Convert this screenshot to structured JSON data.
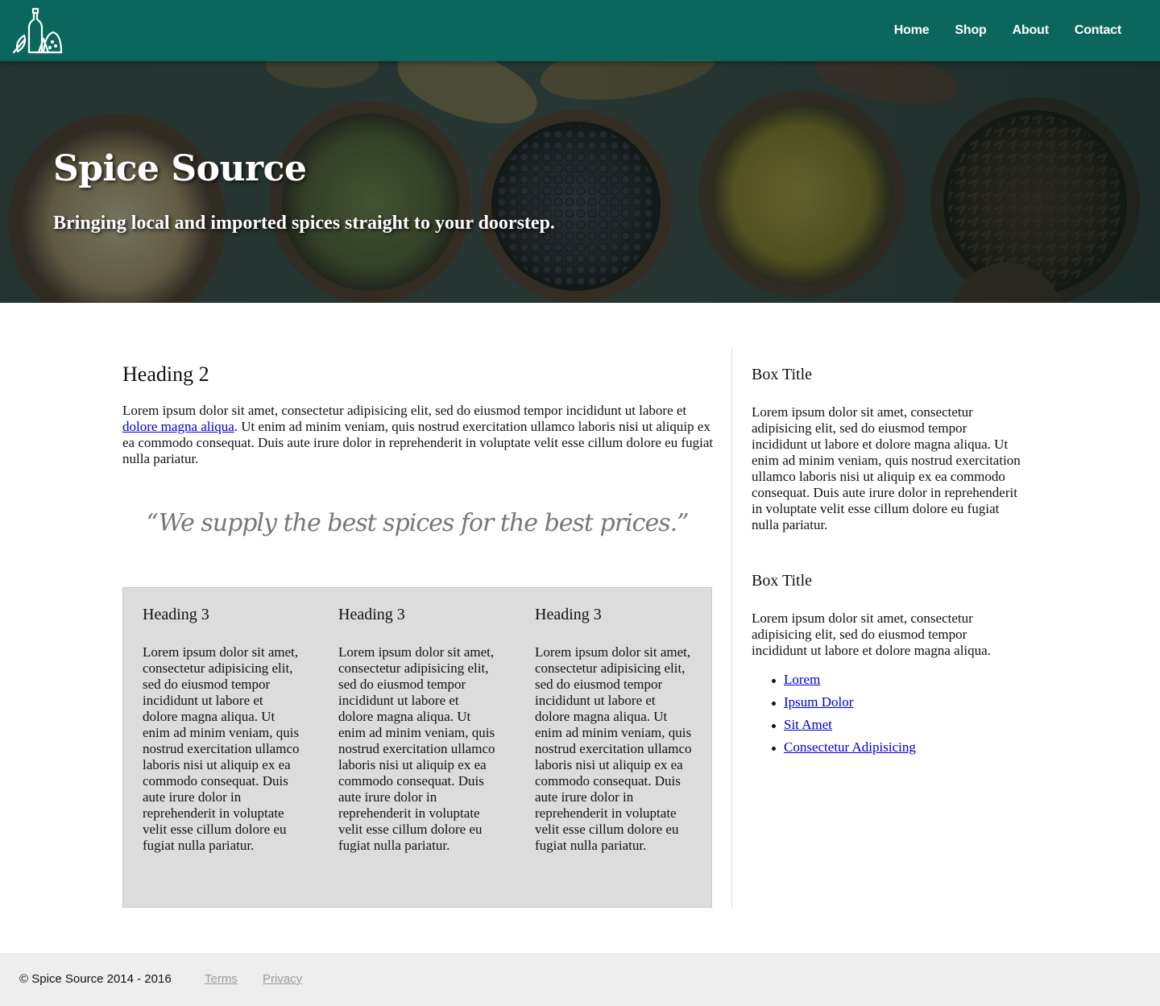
{
  "header": {
    "logo_icon": "spice-jars-logo-icon",
    "background_color": "#0b675d",
    "nav": [
      {
        "label": "Home"
      },
      {
        "label": "Shop"
      },
      {
        "label": "About"
      },
      {
        "label": "Contact"
      }
    ]
  },
  "hero": {
    "title": "Spice Source",
    "tagline": "Bringing local and imported spices straight to your doorstep."
  },
  "main": {
    "heading": "Heading 2",
    "paragraph_before_link": "Lorem ipsum dolor sit amet, consectetur adipisicing elit, sed do eiusmod tempor incididunt ut labore et ",
    "paragraph_link": "dolore magna aliqua",
    "paragraph_after_link": ". Ut enim ad minim veniam, quis nostrud exercitation ullamco laboris nisi ut aliquip ex ea commodo consequat. Duis aute irure dolor in reprehenderit in voluptate velit esse cillum dolore eu fugiat nulla pariatur.",
    "quote": "“We supply the best spices for the best prices.”",
    "columns": [
      {
        "heading": "Heading 3",
        "text": "Lorem ipsum dolor sit amet, consectetur adipisicing elit, sed do eiusmod tempor incididunt ut labore et dolore magna aliqua. Ut enim ad minim veniam, quis nostrud exercitation ullamco laboris nisi ut aliquip ex ea commodo consequat. Duis aute irure dolor in reprehenderit in voluptate velit esse cillum dolore eu fugiat nulla pariatur."
      },
      {
        "heading": "Heading 3",
        "text": "Lorem ipsum dolor sit amet, consectetur adipisicing elit, sed do eiusmod tempor incididunt ut labore et dolore magna aliqua. Ut enim ad minim veniam, quis nostrud exercitation ullamco laboris nisi ut aliquip ex ea commodo consequat. Duis aute irure dolor in reprehenderit in voluptate velit esse cillum dolore eu fugiat nulla pariatur."
      },
      {
        "heading": "Heading 3",
        "text": "Lorem ipsum dolor sit amet, consectetur adipisicing elit, sed do eiusmod tempor incididunt ut labore et dolore magna aliqua. Ut enim ad minim veniam, quis nostrud exercitation ullamco laboris nisi ut aliquip ex ea commodo consequat. Duis aute irure dolor in reprehenderit in voluptate velit esse cillum dolore eu fugiat nulla pariatur."
      }
    ]
  },
  "sidebar": {
    "boxes": [
      {
        "title": "Box Title",
        "text": "Lorem ipsum dolor sit amet, consectetur adipisicing elit, sed do eiusmod tempor incididunt ut labore et dolore magna aliqua. Ut enim ad minim veniam, quis nostrud exercitation ullamco laboris nisi ut aliquip ex ea commodo consequat. Duis aute irure dolor in reprehenderit in voluptate velit esse cillum dolore eu fugiat nulla pariatur."
      },
      {
        "title": "Box Title",
        "text": "Lorem ipsum dolor sit amet, consectetur adipisicing elit, sed do eiusmod tempor incididunt ut labore et dolore magna aliqua."
      }
    ],
    "links": [
      {
        "label": "Lorem"
      },
      {
        "label": "Ipsum Dolor"
      },
      {
        "label": "Sit Amet"
      },
      {
        "label": "Consectetur Adipisicing"
      }
    ]
  },
  "footer": {
    "copyright": "© Spice Source 2014 - 2016",
    "links": [
      {
        "label": "Terms"
      },
      {
        "label": "Privacy"
      }
    ]
  }
}
